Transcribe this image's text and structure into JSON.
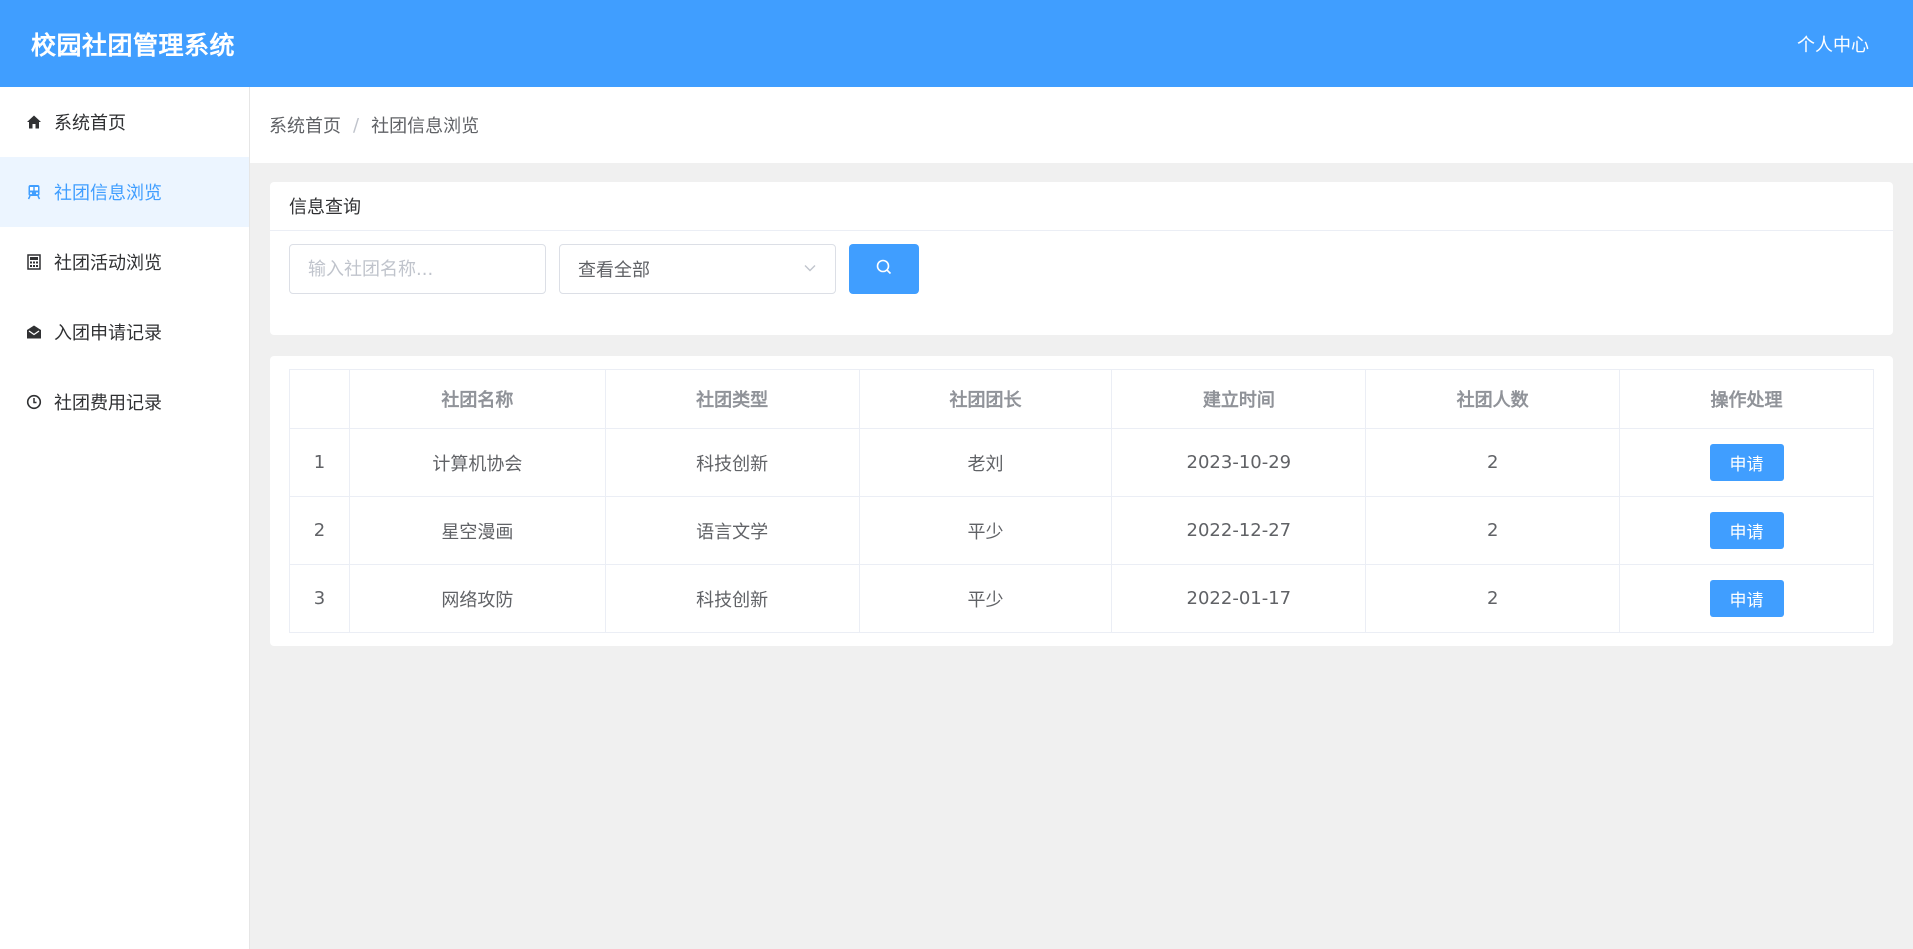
{
  "header": {
    "title": "校园社团管理系统",
    "user_center": "个人中心"
  },
  "sidebar": {
    "items": [
      {
        "label": "系统首页",
        "icon": "home-icon"
      },
      {
        "label": "社团信息浏览",
        "icon": "train-icon",
        "active": true
      },
      {
        "label": "社团活动浏览",
        "icon": "calculator-icon"
      },
      {
        "label": "入团申请记录",
        "icon": "envelope-open-icon"
      },
      {
        "label": "社团费用记录",
        "icon": "clock-icon"
      }
    ]
  },
  "breadcrumb": {
    "home": "系统首页",
    "separator": "/",
    "current": "社团信息浏览"
  },
  "query": {
    "title": "信息查询",
    "search_placeholder": "输入社团名称...",
    "select_value": "查看全部"
  },
  "table": {
    "columns": [
      "",
      "社团名称",
      "社团类型",
      "社团团长",
      "建立时间",
      "社团人数",
      "操作处理"
    ],
    "rows": [
      {
        "index": "1",
        "name": "计算机协会",
        "type": "科技创新",
        "leader": "老刘",
        "date": "2023-10-29",
        "members": "2",
        "action": "申请"
      },
      {
        "index": "2",
        "name": "星空漫画",
        "type": "语言文学",
        "leader": "平少",
        "date": "2022-12-27",
        "members": "2",
        "action": "申请"
      },
      {
        "index": "3",
        "name": "网络攻防",
        "type": "科技创新",
        "leader": "平少",
        "date": "2022-01-17",
        "members": "2",
        "action": "申请"
      }
    ]
  },
  "colors": {
    "primary": "#409eff",
    "active_bg": "#ecf5ff"
  }
}
